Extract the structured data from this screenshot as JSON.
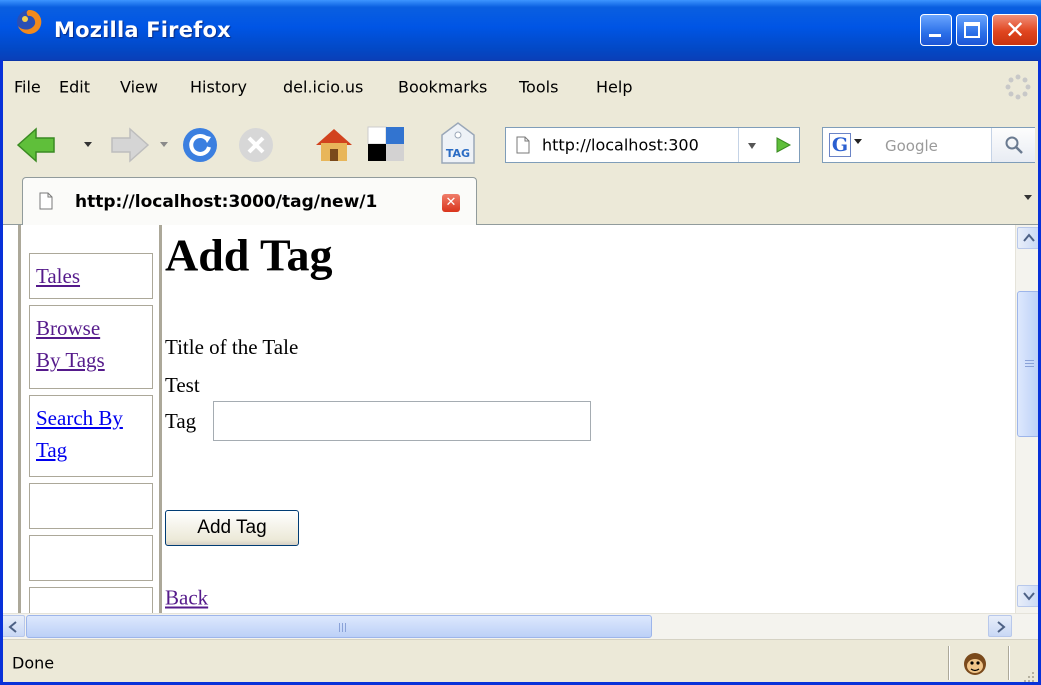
{
  "window": {
    "title": "Mozilla Firefox",
    "accent": "#0055e5",
    "icon": "firefox-icon"
  },
  "menubar": {
    "items": [
      "File",
      "Edit",
      "View",
      "History",
      "del.icio.us",
      "Bookmarks",
      "Tools",
      "Help"
    ]
  },
  "toolbar": {
    "icons": [
      "back-icon",
      "forward-icon",
      "reload-icon",
      "stop-icon",
      "home-icon",
      "delicious-icon",
      "tag-icon"
    ],
    "tag_label": "TAG",
    "url": "http://localhost:300",
    "search_engine_letter": "G",
    "search_placeholder": "Google"
  },
  "tabs": [
    {
      "title": "http://localhost:3000/tag/new/1",
      "active": true
    }
  ],
  "sidebar": {
    "links": [
      {
        "label": "Tales",
        "visited": true
      },
      {
        "label": "Browse By Tags",
        "visited": true
      },
      {
        "label": "Search By Tag",
        "visited": false
      }
    ],
    "visited_color": "#551a8b",
    "link_color": "#0000ee"
  },
  "page": {
    "heading": "Add Tag",
    "title_label": "Title of the Tale",
    "title_value": "Test",
    "tag_label": "Tag",
    "tag_value": "",
    "submit_label": "Add Tag",
    "back_link": "Back"
  },
  "status": {
    "text": "Done"
  }
}
